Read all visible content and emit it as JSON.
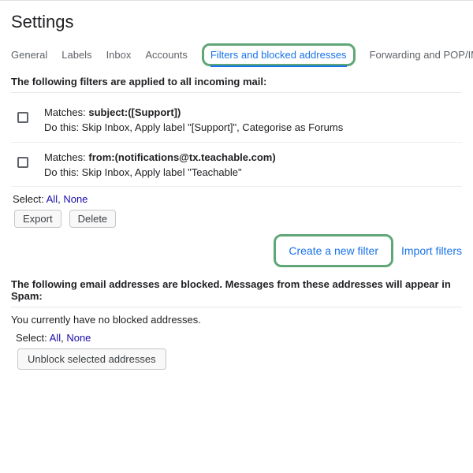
{
  "header": {
    "title": "Settings"
  },
  "tabs": {
    "general": "General",
    "labels": "Labels",
    "inbox": "Inbox",
    "accounts": "Accounts",
    "filters": "Filters and blocked addresses",
    "forwarding": "Forwarding and POP/IMAP"
  },
  "filters_section": {
    "title": "The following filters are applied to all incoming mail:",
    "rows": [
      {
        "matches_prefix": "Matches: ",
        "matches_value": "subject:([Support])",
        "action": "Do this: Skip Inbox, Apply label \"[Support]\", Categorise as Forums"
      },
      {
        "matches_prefix": "Matches: ",
        "matches_value": "from:(notifications@tx.teachable.com)",
        "action": "Do this: Skip Inbox, Apply label \"Teachable\""
      }
    ],
    "select_label": "Select: ",
    "select_all": "All",
    "select_none": "None",
    "export": "Export",
    "delete": "Delete",
    "create_filter": "Create a new filter",
    "import_filters": "Import filters"
  },
  "blocked_section": {
    "title": "The following email addresses are blocked. Messages from these addresses will appear in Spam:",
    "empty": "You currently have no blocked addresses.",
    "select_label": "Select: ",
    "select_all": "All",
    "select_none": "None",
    "unblock": "Unblock selected addresses"
  }
}
